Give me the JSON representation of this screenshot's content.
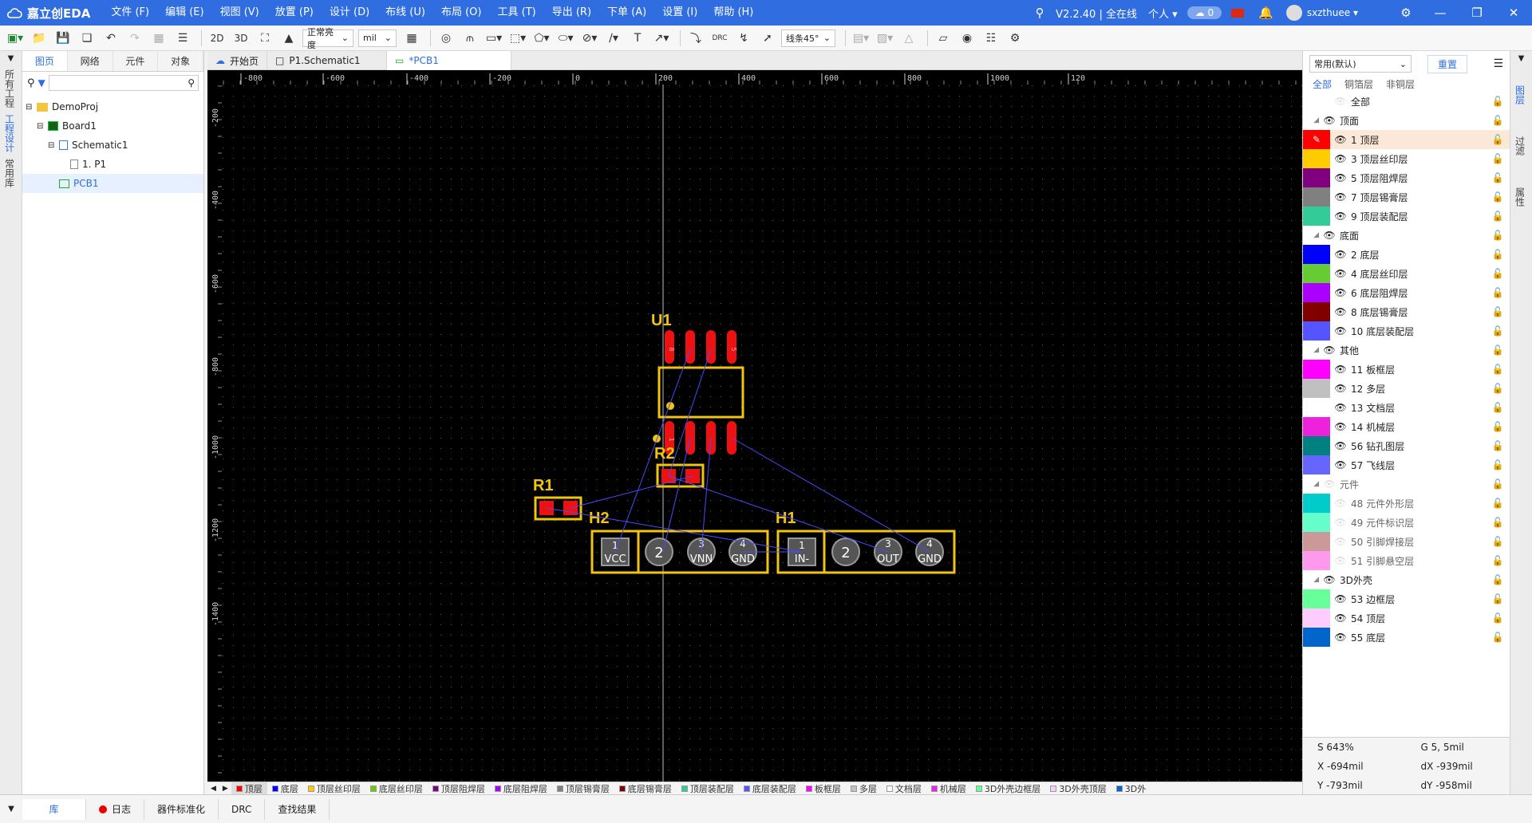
{
  "app": {
    "logo": "嘉立创EDA",
    "menu": [
      "文件 (F)",
      "编辑 (E)",
      "视图 (V)",
      "放置 (P)",
      "设计 (D)",
      "布线 (U)",
      "布局 (O)",
      "工具 (T)",
      "导出 (R)",
      "下单 (A)",
      "设置 (I)",
      "帮助 (H)"
    ],
    "version": "V2.2.40 | 全在线",
    "mode": "个人",
    "cloud_count": "0",
    "username": "sxzthuee"
  },
  "toolbar": {
    "view_2d": "2D",
    "view_3d": "3D",
    "brightness": "正常亮度",
    "unit": "mil",
    "drc": "DRC",
    "route_angle": "线条45°"
  },
  "left_strip": [
    "所有工程",
    "工程设计",
    "常用库"
  ],
  "left_panel": {
    "tabs": [
      "图页",
      "网络",
      "元件",
      "对象"
    ],
    "tree": [
      {
        "label": "DemoProj",
        "level": 0,
        "icon": "folder"
      },
      {
        "label": "Board1",
        "level": 1,
        "icon": "board"
      },
      {
        "label": "Schematic1",
        "level": 2,
        "icon": "schematic"
      },
      {
        "label": "1. P1",
        "level": 3,
        "icon": "page"
      },
      {
        "label": "PCB1",
        "level": 2,
        "icon": "pcb"
      }
    ]
  },
  "doc_tabs": [
    "开始页",
    "P1.Schematic1",
    "*PCB1"
  ],
  "ruler": {
    "top": [
      "-800",
      "-600",
      "-400",
      "-200",
      "0",
      "200",
      "400",
      "600",
      "800",
      "1000",
      "120"
    ],
    "left": [
      "-200",
      "-400",
      "-600",
      "-800",
      "-1000",
      "-1200",
      "-1400"
    ]
  },
  "pcb": {
    "designators": [
      "U1",
      "R2",
      "R1",
      "H2",
      "H1"
    ],
    "u1_pins_top": [
      "8",
      "5"
    ],
    "u1_pins_bottom": [
      "1"
    ],
    "h2_pins": [
      {
        "num": "1",
        "name": "VCC"
      },
      {
        "num": "2",
        "name": ""
      },
      {
        "num": "3",
        "name": "VNN"
      },
      {
        "num": "4",
        "name": "GND"
      }
    ],
    "h1_pins": [
      {
        "num": "1",
        "name": "IN-"
      },
      {
        "num": "2",
        "name": ""
      },
      {
        "num": "3",
        "name": "OUT"
      },
      {
        "num": "4",
        "name": "GND"
      }
    ]
  },
  "layer_bar": [
    {
      "name": "顶层",
      "color": "#ff0000"
    },
    {
      "name": "底层",
      "color": "#0000ff"
    },
    {
      "name": "顶层丝印层",
      "color": "#ffcc00"
    },
    {
      "name": "底层丝印层",
      "color": "#66cc00"
    },
    {
      "name": "顶层阻焊层",
      "color": "#800080"
    },
    {
      "name": "底层阻焊层",
      "color": "#aa00ff"
    },
    {
      "name": "顶层锡膏层",
      "color": "#808080"
    },
    {
      "name": "底层锡膏层",
      "color": "#800000"
    },
    {
      "name": "顶层装配层",
      "color": "#33cc99"
    },
    {
      "name": "底层装配层",
      "color": "#5555ff"
    },
    {
      "name": "板框层",
      "color": "#ff00ff"
    },
    {
      "name": "多层",
      "color": "#c0c0c0"
    },
    {
      "name": "文档层",
      "color": "#ffffff"
    },
    {
      "name": "机械层",
      "color": "#ee22ee"
    },
    {
      "name": "3D外壳边框层",
      "color": "#66ff99"
    },
    {
      "name": "3D外壳顶层",
      "color": "#ffccff"
    },
    {
      "name": "3D外",
      "color": "#0066cc"
    }
  ],
  "right_panel": {
    "preset": "常用(默认)",
    "reset": "重置",
    "filter_tabs": [
      "全部",
      "铜箔层",
      "非铜层"
    ],
    "layers": [
      {
        "name": "全部",
        "type": "group-all",
        "color": ""
      },
      {
        "name": "顶面",
        "type": "group",
        "color": ""
      },
      {
        "name": "1 顶层",
        "type": "layer",
        "color": "#ff0000",
        "active": true
      },
      {
        "name": "3 顶层丝印层",
        "type": "layer",
        "color": "#ffcc00"
      },
      {
        "name": "5 顶层阻焊层",
        "type": "layer",
        "color": "#800080"
      },
      {
        "name": "7 顶层锡膏层",
        "type": "layer",
        "color": "#808080"
      },
      {
        "name": "9 顶层装配层",
        "type": "layer",
        "color": "#33cc99"
      },
      {
        "name": "底面",
        "type": "group",
        "color": ""
      },
      {
        "name": "2 底层",
        "type": "layer",
        "color": "#0000ff"
      },
      {
        "name": "4 底层丝印层",
        "type": "layer",
        "color": "#66cc33"
      },
      {
        "name": "6 底层阻焊层",
        "type": "layer",
        "color": "#aa00ff"
      },
      {
        "name": "8 底层锡膏层",
        "type": "layer",
        "color": "#800000"
      },
      {
        "name": "10 底层装配层",
        "type": "layer",
        "color": "#5555ff"
      },
      {
        "name": "其他",
        "type": "group",
        "color": ""
      },
      {
        "name": "11 板框层",
        "type": "layer",
        "color": "#ff00ff"
      },
      {
        "name": "12 多层",
        "type": "layer",
        "color": "#c0c0c0"
      },
      {
        "name": "13 文档层",
        "type": "layer",
        "color": "#ffffff"
      },
      {
        "name": "14 机械层",
        "type": "layer",
        "color": "#ee22dd"
      },
      {
        "name": "56 钻孔图层",
        "type": "layer",
        "color": "#008080"
      },
      {
        "name": "57 飞线层",
        "type": "layer",
        "color": "#6666ff",
        "lock_blue": true
      },
      {
        "name": "元件",
        "type": "group-dim",
        "color": ""
      },
      {
        "name": "48 元件外形层",
        "type": "layer-dim",
        "color": "#00cccc"
      },
      {
        "name": "49 元件标识层",
        "type": "layer-dim",
        "color": "#66ffcc"
      },
      {
        "name": "50 引脚焊接层",
        "type": "layer-dim",
        "color": "#cc9999"
      },
      {
        "name": "51 引脚悬空层",
        "type": "layer-dim",
        "color": "#ff99ee"
      },
      {
        "name": "3D外壳",
        "type": "group",
        "color": ""
      },
      {
        "name": "53 边框层",
        "type": "layer",
        "color": "#66ff99"
      },
      {
        "name": "54 顶层",
        "type": "layer",
        "color": "#ffccff"
      },
      {
        "name": "55 底层",
        "type": "layer",
        "color": "#0066cc"
      }
    ]
  },
  "right_strip": [
    "图层",
    "过滤",
    "属性"
  ],
  "status": {
    "s": "S   643%",
    "g": "G   5, 5mil",
    "x": "X   -694mil",
    "dx": "dX   -939mil",
    "y": "Y   -793mil",
    "dy": "dY   -958mil"
  },
  "bottom_tabs": [
    "库",
    "日志",
    "器件标准化",
    "DRC",
    "查找结果"
  ]
}
